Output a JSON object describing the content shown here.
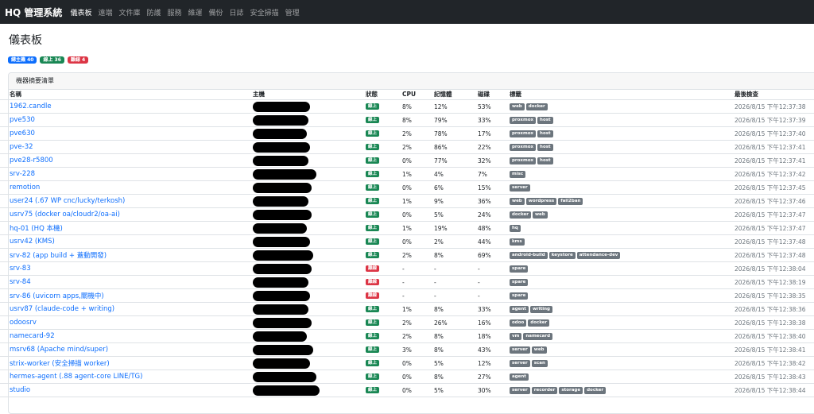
{
  "nav": {
    "brand": "HQ 管理系統",
    "items": [
      "儀表板",
      "遠端",
      "文件庫",
      "防護",
      "服務",
      "維運",
      "備份",
      "日誌",
      "安全掃描",
      "管理"
    ],
    "active": 0
  },
  "page": {
    "title": "儀表板",
    "badges": [
      {
        "label": "總主機 40",
        "color": "#0d6efd"
      },
      {
        "label": "線上 36",
        "color": "#198754"
      },
      {
        "label": "離線 4",
        "color": "#dc3545"
      }
    ]
  },
  "card": {
    "header": "機器摘要清單"
  },
  "colors": {
    "online": "#198754",
    "offline": "#dc3545",
    "tag": "#6c757d",
    "link": "#0d6efd"
  },
  "table": {
    "headers": {
      "name": "名稱",
      "host": "主機",
      "status": "狀態",
      "cpu": "CPU",
      "mem": "記憶體",
      "disk": "磁碟",
      "tags": "標籤",
      "checked": "最後檢查"
    },
    "rows": [
      {
        "name": "1962.candle",
        "status": "線上",
        "online": true,
        "cpu": "8%",
        "mem": "12%",
        "disk": "53%",
        "tags": [
          "web",
          "docker"
        ],
        "checked": "2026/8/15 下午12:37:38"
      },
      {
        "name": "pve530",
        "status": "線上",
        "online": true,
        "cpu": "8%",
        "mem": "79%",
        "disk": "33%",
        "tags": [
          "proxmox",
          "host"
        ],
        "checked": "2026/8/15 下午12:37:39"
      },
      {
        "name": "pve630",
        "status": "線上",
        "online": true,
        "cpu": "2%",
        "mem": "78%",
        "disk": "17%",
        "tags": [
          "proxmox",
          "host"
        ],
        "checked": "2026/8/15 下午12:37:40"
      },
      {
        "name": "pve-32",
        "status": "線上",
        "online": true,
        "cpu": "2%",
        "mem": "86%",
        "disk": "22%",
        "tags": [
          "proxmox",
          "host"
        ],
        "checked": "2026/8/15 下午12:37:41"
      },
      {
        "name": "pve28-r5800",
        "status": "線上",
        "online": true,
        "cpu": "0%",
        "mem": "77%",
        "disk": "32%",
        "tags": [
          "proxmox",
          "host"
        ],
        "checked": "2026/8/15 下午12:37:41"
      },
      {
        "name": "srv-228",
        "status": "線上",
        "online": true,
        "cpu": "1%",
        "mem": "4%",
        "disk": "7%",
        "tags": [
          "misc"
        ],
        "checked": "2026/8/15 下午12:37:42"
      },
      {
        "name": "remotion",
        "status": "線上",
        "online": true,
        "cpu": "0%",
        "mem": "6%",
        "disk": "15%",
        "tags": [
          "server"
        ],
        "checked": "2026/8/15 下午12:37:45"
      },
      {
        "name": "user24 (.67 WP cnc/lucky/terkosh)",
        "status": "線上",
        "online": true,
        "cpu": "1%",
        "mem": "9%",
        "disk": "36%",
        "tags": [
          "web",
          "wordpress",
          "fail2ban"
        ],
        "checked": "2026/8/15 下午12:37:46"
      },
      {
        "name": "usrv75 (docker oa/cloudr2/oa-ai)",
        "status": "線上",
        "online": true,
        "cpu": "0%",
        "mem": "5%",
        "disk": "24%",
        "tags": [
          "docker",
          "web"
        ],
        "checked": "2026/8/15 下午12:37:47"
      },
      {
        "name": "hq-01 (HQ 本機)",
        "status": "線上",
        "online": true,
        "cpu": "1%",
        "mem": "19%",
        "disk": "48%",
        "tags": [
          "hq"
        ],
        "checked": "2026/8/15 下午12:37:47"
      },
      {
        "name": "usrv42 (KMS)",
        "status": "線上",
        "online": true,
        "cpu": "0%",
        "mem": "2%",
        "disk": "44%",
        "tags": [
          "kms"
        ],
        "checked": "2026/8/15 下午12:37:48"
      },
      {
        "name": "srv-82 (app build + 蓋動開發)",
        "status": "線上",
        "online": true,
        "cpu": "2%",
        "mem": "8%",
        "disk": "69%",
        "tags": [
          "android-build",
          "keystore",
          "attendance-dev"
        ],
        "checked": "2026/8/15 下午12:37:48"
      },
      {
        "name": "srv-83",
        "status": "離線",
        "online": false,
        "cpu": "-",
        "mem": "-",
        "disk": "-",
        "tags": [
          "spare"
        ],
        "checked": "2026/8/15 下午12:38:04"
      },
      {
        "name": "srv-84",
        "status": "離線",
        "online": false,
        "cpu": "-",
        "mem": "-",
        "disk": "-",
        "tags": [
          "spare"
        ],
        "checked": "2026/8/15 下午12:38:19"
      },
      {
        "name": "srv-86 (uvicorn apps,關機中)",
        "status": "離線",
        "online": false,
        "cpu": "-",
        "mem": "-",
        "disk": "-",
        "tags": [
          "spare"
        ],
        "checked": "2026/8/15 下午12:38:35"
      },
      {
        "name": "usrv87 (claude-code + writing)",
        "status": "線上",
        "online": true,
        "cpu": "1%",
        "mem": "8%",
        "disk": "33%",
        "tags": [
          "agent",
          "writing"
        ],
        "checked": "2026/8/15 下午12:38:36"
      },
      {
        "name": "odoosrv",
        "status": "線上",
        "online": true,
        "cpu": "2%",
        "mem": "26%",
        "disk": "16%",
        "tags": [
          "odoo",
          "docker"
        ],
        "checked": "2026/8/15 下午12:38:38"
      },
      {
        "name": "namecard-92",
        "status": "線上",
        "online": true,
        "cpu": "2%",
        "mem": "8%",
        "disk": "18%",
        "tags": [
          "vm",
          "namecard"
        ],
        "checked": "2026/8/15 下午12:38:40"
      },
      {
        "name": "msrv68 (Apache mind/super)",
        "status": "線上",
        "online": true,
        "cpu": "3%",
        "mem": "8%",
        "disk": "43%",
        "tags": [
          "server",
          "web"
        ],
        "checked": "2026/8/15 下午12:38:41"
      },
      {
        "name": "strix-worker (安全掃描 worker)",
        "status": "線上",
        "online": true,
        "cpu": "0%",
        "mem": "5%",
        "disk": "12%",
        "tags": [
          "server",
          "scan"
        ],
        "checked": "2026/8/15 下午12:38:42"
      },
      {
        "name": "hermes-agent (.88 agent-core LINE/TG)",
        "status": "線上",
        "online": true,
        "cpu": "0%",
        "mem": "8%",
        "disk": "27%",
        "tags": [
          "agent"
        ],
        "checked": "2026/8/15 下午12:38:43"
      },
      {
        "name": "studio",
        "status": "線上",
        "online": true,
        "cpu": "0%",
        "mem": "5%",
        "disk": "30%",
        "tags": [
          "server",
          "recorder",
          "storage",
          "docker"
        ],
        "checked": "2026/8/15 下午12:38:44"
      }
    ]
  }
}
